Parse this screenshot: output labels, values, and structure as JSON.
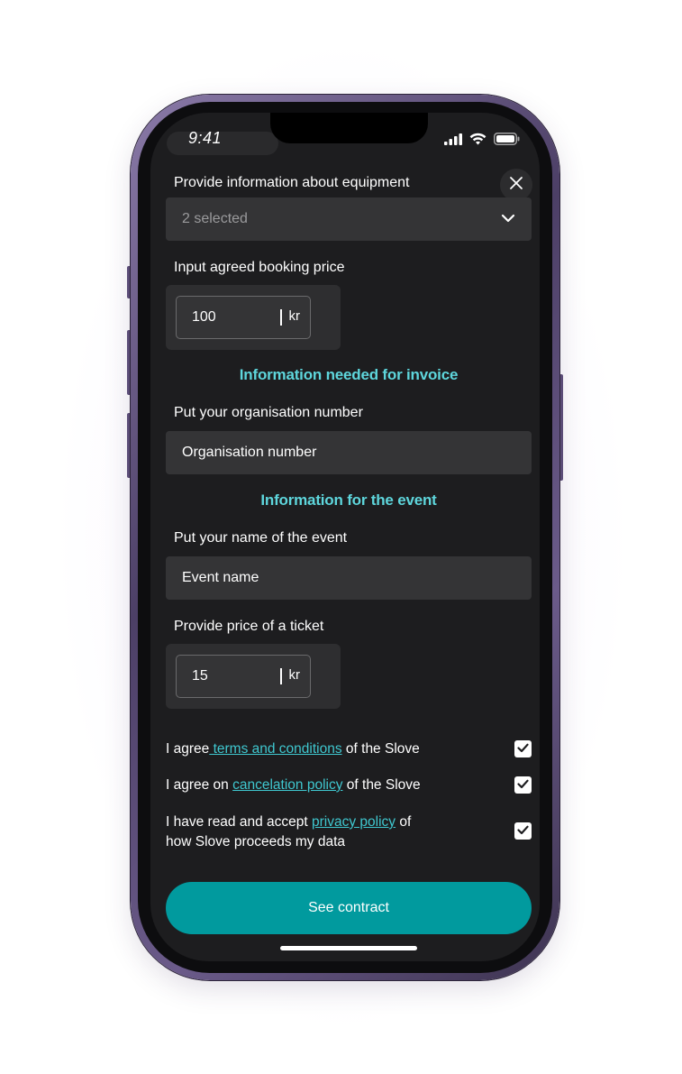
{
  "status_bar": {
    "time": "9:41"
  },
  "equipment": {
    "label": "Provide information about equipment",
    "value": "2 selected"
  },
  "booking_price": {
    "label": "Input agreed booking price",
    "value": "100",
    "unit": "kr"
  },
  "invoice_section": {
    "title": "Information needed for invoice"
  },
  "organisation": {
    "label": "Put your organisation number",
    "placeholder": "Organisation number"
  },
  "event_section": {
    "title": "Information for the event"
  },
  "event_name": {
    "label": "Put your name of the event",
    "placeholder": "Event name"
  },
  "ticket_price": {
    "label": "Provide price of a ticket",
    "value": "15",
    "unit": "kr"
  },
  "agreements": [
    {
      "prefix": "I agree",
      "link": " terms and conditions",
      "suffix": " of the Slove",
      "checked": true
    },
    {
      "prefix": "I agree on ",
      "link": "cancelation policy",
      "suffix": " of the Slove",
      "checked": true
    },
    {
      "prefix": "I have read and accept ",
      "link": "privacy policy",
      "suffix": " of",
      "line2": "how Slove proceeds my data",
      "checked": true
    }
  ],
  "cta": {
    "label": "See contract"
  },
  "colors": {
    "accent": "#019a9e",
    "section_title": "#5ed6dc",
    "link": "#3fc7cf",
    "background": "#1d1d1f",
    "field": "#343436"
  }
}
